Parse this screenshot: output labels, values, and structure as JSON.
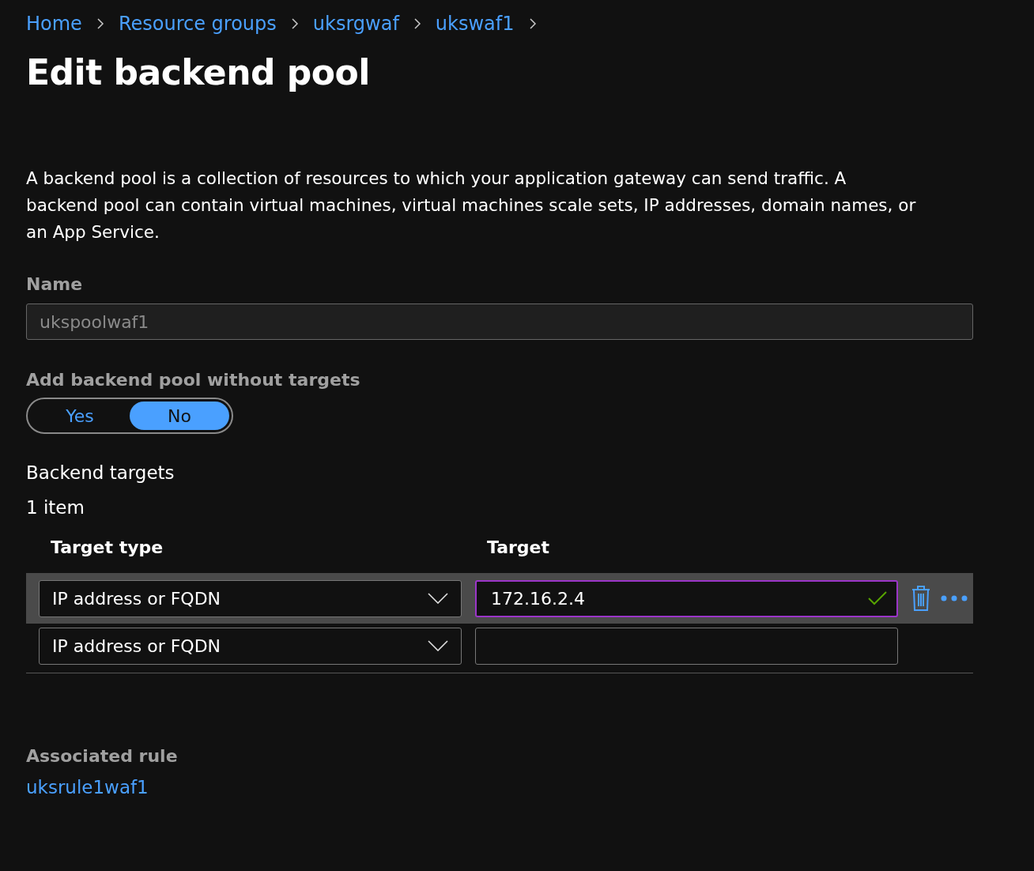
{
  "breadcrumb": [
    {
      "label": "Home"
    },
    {
      "label": "Resource groups"
    },
    {
      "label": "uksrgwaf"
    },
    {
      "label": "ukswaf1"
    }
  ],
  "title": "Edit backend pool",
  "description": "A backend pool is a collection of resources to which your application gateway can send traffic. A backend pool can contain virtual machines, virtual machines scale sets, IP addresses, domain names, or an App Service.",
  "name_field": {
    "label": "Name",
    "value": "ukspoolwaf1",
    "disabled": true
  },
  "without_targets": {
    "label": "Add backend pool without targets",
    "options": [
      {
        "label": "Yes",
        "selected": false
      },
      {
        "label": "No",
        "selected": true
      }
    ]
  },
  "backend_targets": {
    "heading": "Backend targets",
    "count": "1 item",
    "columns": [
      "Target type",
      "Target"
    ],
    "rows": [
      {
        "target_type": "IP address or FQDN",
        "target": "172.16.2.4",
        "selected": true,
        "valid": true
      },
      {
        "target_type": "IP address or FQDN",
        "selected": false,
        "valid": false
      }
    ]
  },
  "associated_rule": {
    "label": "Associated rule",
    "link": "uksrule1waf1"
  }
}
